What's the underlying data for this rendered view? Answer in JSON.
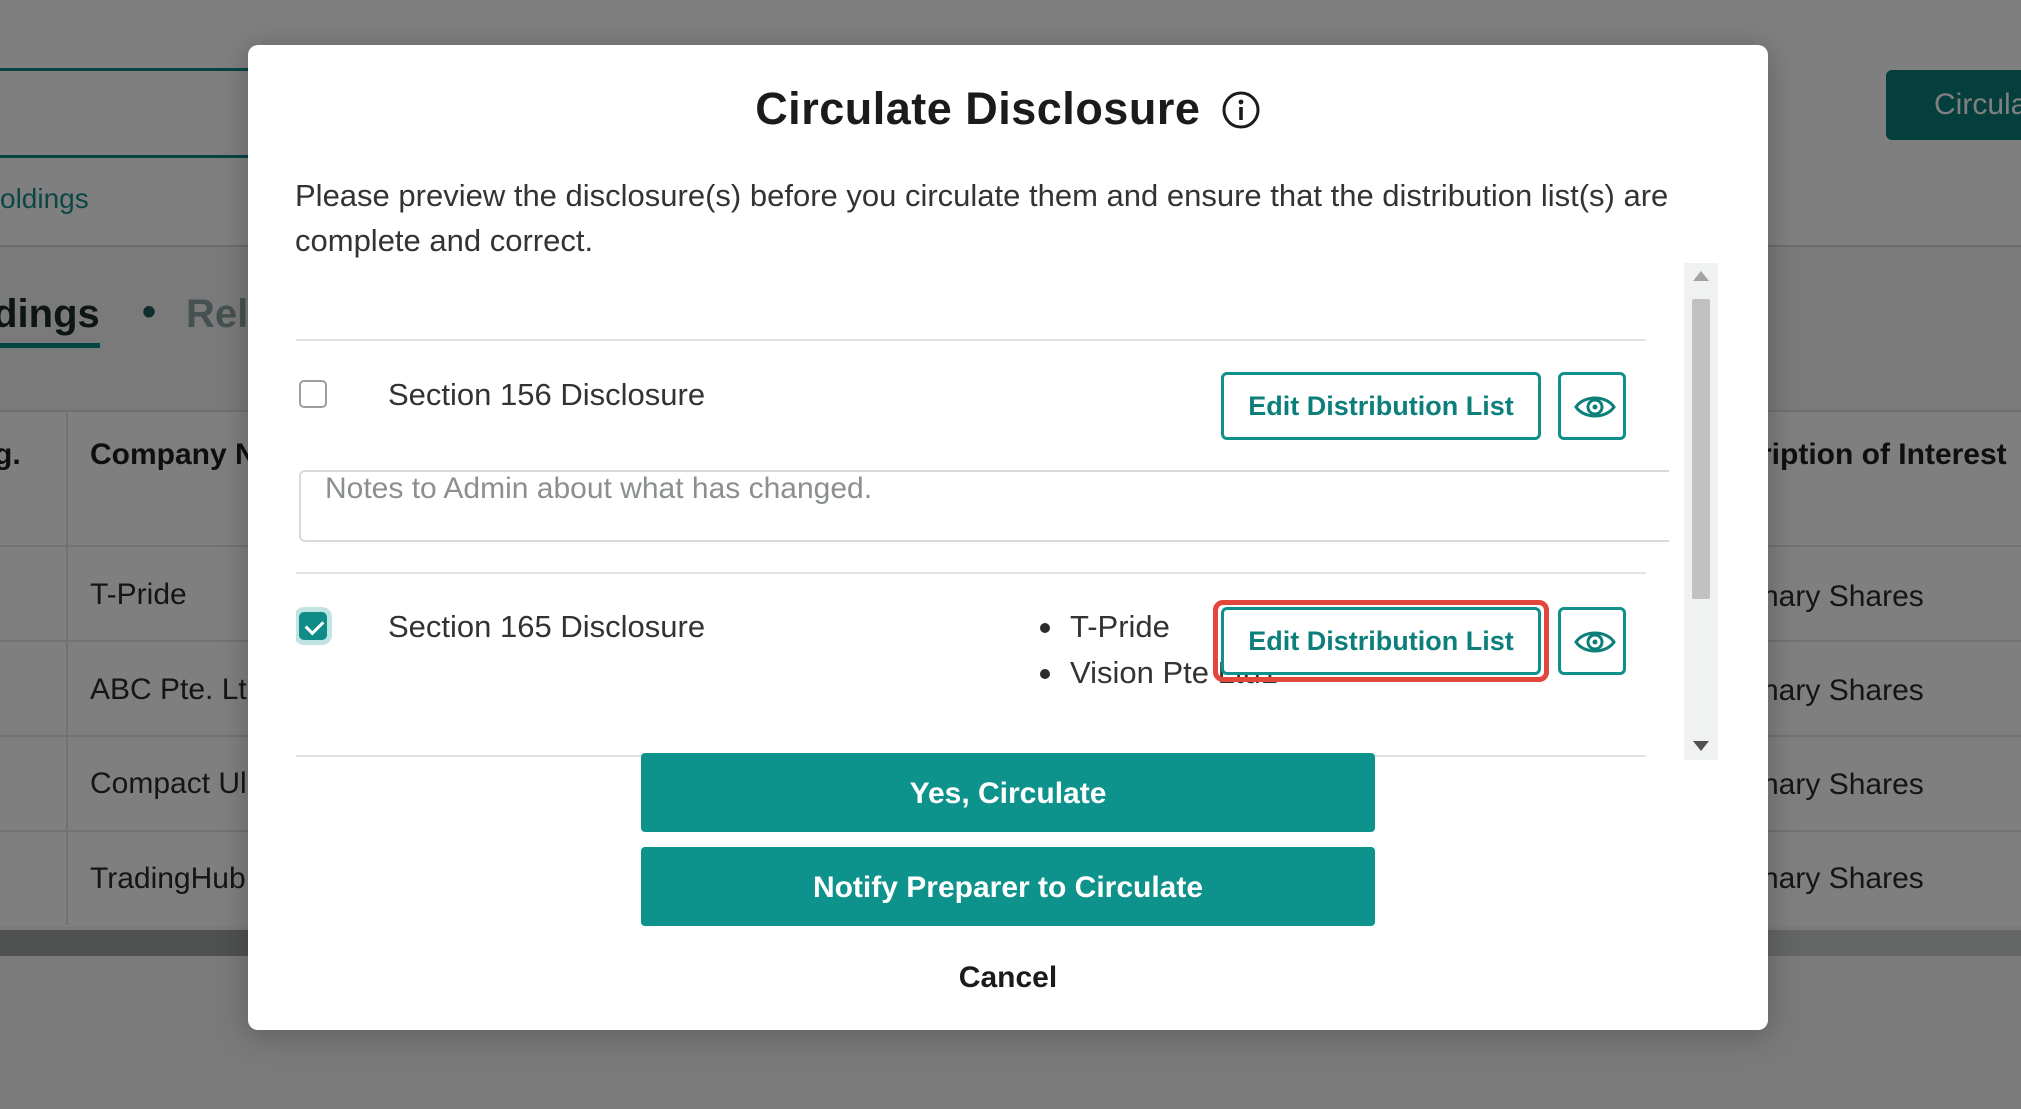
{
  "background": {
    "search_link": "oldings",
    "circulate_button": "Circula",
    "tabs": [
      "ldings",
      "•",
      "Rel"
    ],
    "table_headers": [
      "g.",
      "Company N",
      "ription of Interest"
    ],
    "rows": [
      {
        "company": "T-Pride",
        "interest": "nary Shares"
      },
      {
        "company": "ABC Pte. Ltd",
        "interest": "nary Shares"
      },
      {
        "company": "Compact Ul",
        "interest": "nary Shares"
      },
      {
        "company": "TradingHub",
        "interest": "nary Shares"
      }
    ]
  },
  "modal": {
    "title": "Circulate Disclosure",
    "title_icon": "info-circle-icon",
    "intro": "Please preview the disclosure(s) before you circulate them and ensure that the distribution list(s) are complete and correct.",
    "disclosures": [
      {
        "label": "Section 156 Disclosure",
        "checked": false,
        "edit_label": "Edit Distribution List",
        "preview_icon": "eye-icon",
        "distribution": []
      },
      {
        "label": "Section 165 Disclosure",
        "checked": true,
        "edit_label": "Edit Distribution List",
        "preview_icon": "eye-icon",
        "distribution": [
          "T-Pride",
          "Vision Pte Ltd1"
        ]
      }
    ],
    "notes_placeholder": "Notes to Admin about what has changed.",
    "yes_button": "Yes, Circulate",
    "notify_button": "Notify Preparer to Circulate",
    "cancel_label": "Cancel"
  },
  "colors": {
    "accent": "#0e928c",
    "highlight": "#e1473a",
    "overlay": "rgba(0,0,0,0.5)"
  }
}
